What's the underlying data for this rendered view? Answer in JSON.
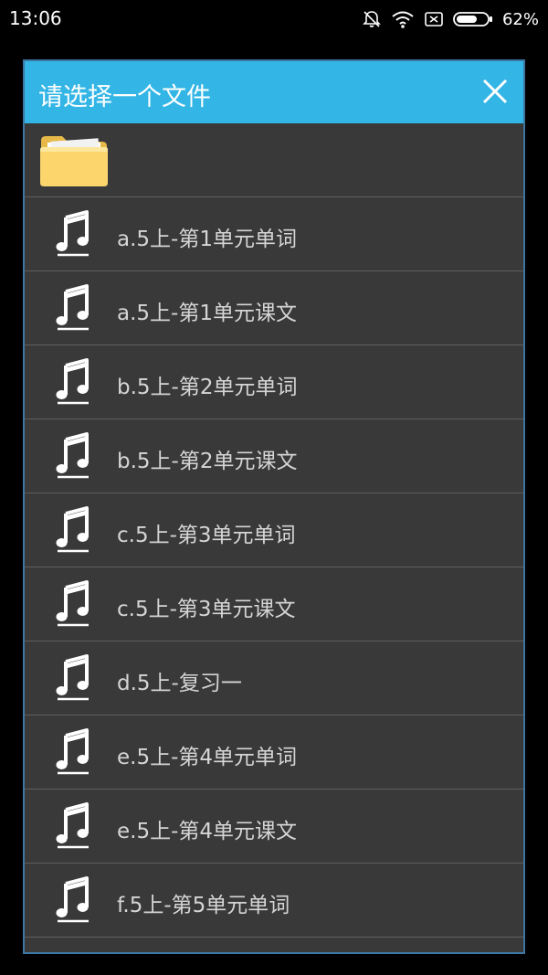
{
  "status_bar": {
    "time": "13:06",
    "battery_percent": "62%",
    "icons": [
      "bell-muted-icon",
      "wifi-icon",
      "sim-error-icon",
      "battery-icon"
    ]
  },
  "dialog": {
    "title": "请选择一个文件",
    "close_icon": "close-icon",
    "folder_icon": "folder-icon",
    "file_icon": "music-note-icon",
    "header_color": "#33b5e5",
    "background_color": "#393939",
    "files": [
      {
        "name": "a.5上-第1单元单词"
      },
      {
        "name": "a.5上-第1单元课文"
      },
      {
        "name": "b.5上-第2单元单词"
      },
      {
        "name": "b.5上-第2单元课文"
      },
      {
        "name": "c.5上-第3单元单词"
      },
      {
        "name": "c.5上-第3单元课文"
      },
      {
        "name": "d.5上-复习一"
      },
      {
        "name": "e.5上-第4单元单词"
      },
      {
        "name": "e.5上-第4单元课文"
      },
      {
        "name": "f.5上-第5单元单词"
      }
    ]
  }
}
